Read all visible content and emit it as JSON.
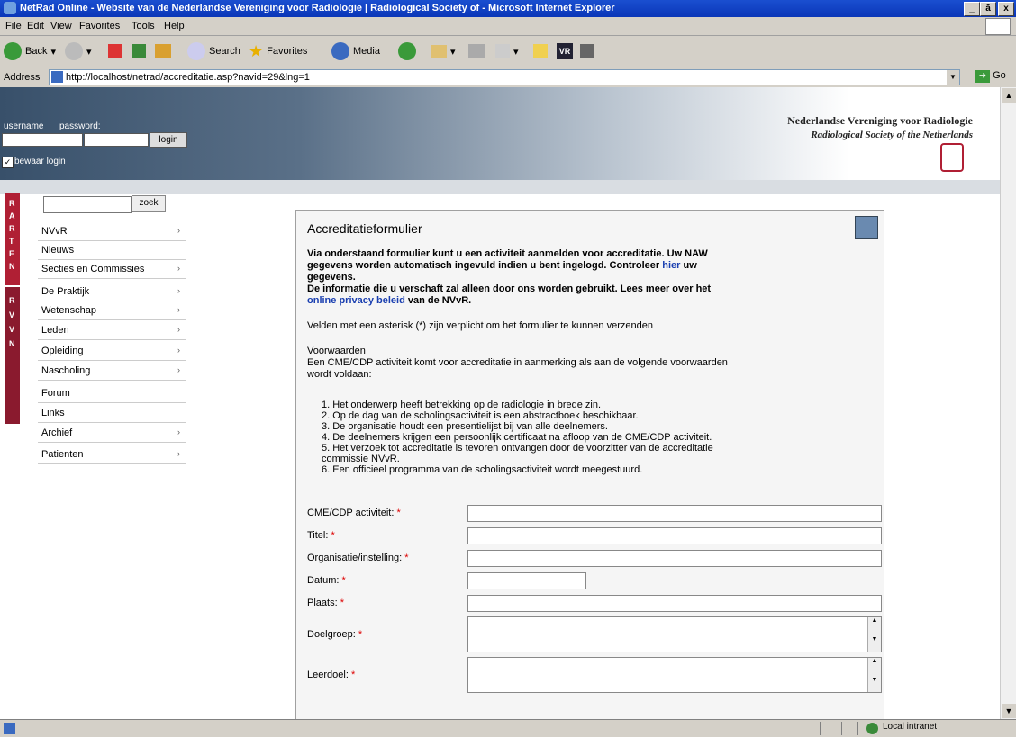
{
  "window": {
    "title": "NetRad Online - Website van de Nederlandse Vereniging voor Radiologie | Radiological Society of - Microsoft Internet Explorer",
    "min": "_",
    "max": "ā",
    "close": "x"
  },
  "menu": [
    "File",
    "Edit",
    "View",
    "Favorites",
    "Tools",
    "Help"
  ],
  "toolbar": {
    "back": "Back",
    "search": "Search",
    "favorites": "Favorites",
    "media": "Media"
  },
  "address": {
    "label": "Address",
    "url": "http://localhost/netrad/accreditatie.asp?navid=29&lng=1",
    "go": "Go"
  },
  "header": {
    "username_label": "username",
    "password_label": "password:",
    "login_button": "login",
    "remember_label": "bewaar login",
    "org_nl": "Nederlandse Vereniging voor Radiologie",
    "org_en": "Radiological Society of the Netherlands"
  },
  "sidebar": {
    "search_button": "zoek",
    "band1": "NETRAD",
    "band2": "NVVR",
    "items": [
      {
        "label": "NVvR",
        "arrow": "›"
      },
      {
        "label": "Nieuws",
        "arrow": ""
      },
      {
        "label": "Secties en Commissies",
        "arrow": "›"
      },
      {
        "label": "De Praktijk",
        "arrow": "›"
      },
      {
        "label": "Wetenschap",
        "arrow": "›"
      },
      {
        "label": "Leden",
        "arrow": "›"
      },
      {
        "label": "Opleiding",
        "arrow": "›"
      },
      {
        "label": "Nascholing",
        "arrow": "›"
      },
      {
        "label": "Forum",
        "arrow": ""
      },
      {
        "label": "Links",
        "arrow": ""
      },
      {
        "label": "Archief",
        "arrow": "›"
      },
      {
        "label": "Patienten",
        "arrow": "›"
      }
    ]
  },
  "form": {
    "title": "Accreditatieformulier",
    "intro1": "Via onderstaand formulier kunt u een activiteit aanmelden voor accreditatie. Uw NAW",
    "intro2": "gegevens worden automatisch ingevuld indien u bent ingelogd. Controleer",
    "intro2_link": "hier",
    "intro2_end": "uw",
    "intro3": "gegevens.",
    "privacy1": "De informatie die u verschaft zal alleen door ons worden gebruikt. Lees meer over het",
    "privacy_link": "online privacy beleid",
    "privacy_end": "van de NVvR.",
    "required_note": "Velden met een asterisk (*) zijn verplicht om het formulier te kunnen verzenden",
    "conditions_head": "Voorwaarden",
    "conditions_intro1": "Een CME/CDP activiteit komt voor accreditatie in aanmerking als aan de volgende voorwaarden",
    "conditions_intro2": "wordt voldaan:",
    "conditions": [
      "1.  Het onderwerp heeft betrekking op de radiologie in brede zin.",
      "2.  Op de dag van de scholingsactiviteit is een abstractboek beschikbaar.",
      "3.  De organisatie houdt een presentielijst bij van alle deelnemers.",
      "4.  De deelnemers krijgen een persoonlijk certificaat na afloop van de CME/CDP activiteit.",
      "5.  Het verzoek tot accreditatie is tevoren ontvangen door de voorzitter van de accreditatie",
      "     commissie NVvR.",
      "6.  Een officieel programma van de scholingsactiviteit wordt meegestuurd."
    ],
    "fields": [
      "CME/CDP activiteit:",
      "Titel:",
      "Organisatie/instelling:",
      "Datum:",
      "Plaats:",
      "Doelgroep:",
      "Leerdoel:"
    ],
    "asterisk": "*"
  },
  "status": {
    "zone": "Local intranet"
  }
}
